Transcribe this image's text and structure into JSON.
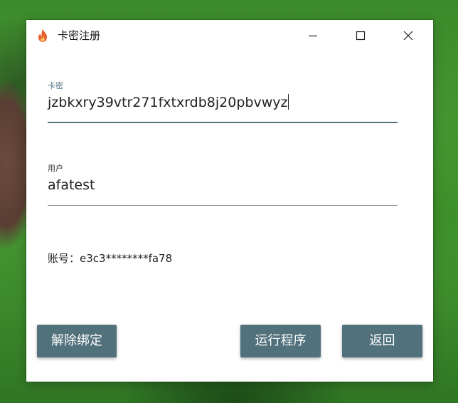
{
  "window": {
    "title": "卡密注册",
    "controls": {
      "minimize": "minimize",
      "maximize": "maximize",
      "close": "close"
    }
  },
  "form": {
    "card_key": {
      "label": "卡密",
      "value": "jzbkxry39vtr271fxtxrdb8j20pbvwyz"
    },
    "user": {
      "label": "用户",
      "value": "afatest"
    },
    "account_text": "账号：e3c3********fa78"
  },
  "buttons": {
    "unbind": "解除绑定",
    "run": "运行程序",
    "back": "返回"
  },
  "colors": {
    "accent": "#51727e",
    "button_bg": "#51717c",
    "button_text": "#ffffff",
    "window_bg": "#ffffff",
    "app_icon": "#e8602c"
  }
}
